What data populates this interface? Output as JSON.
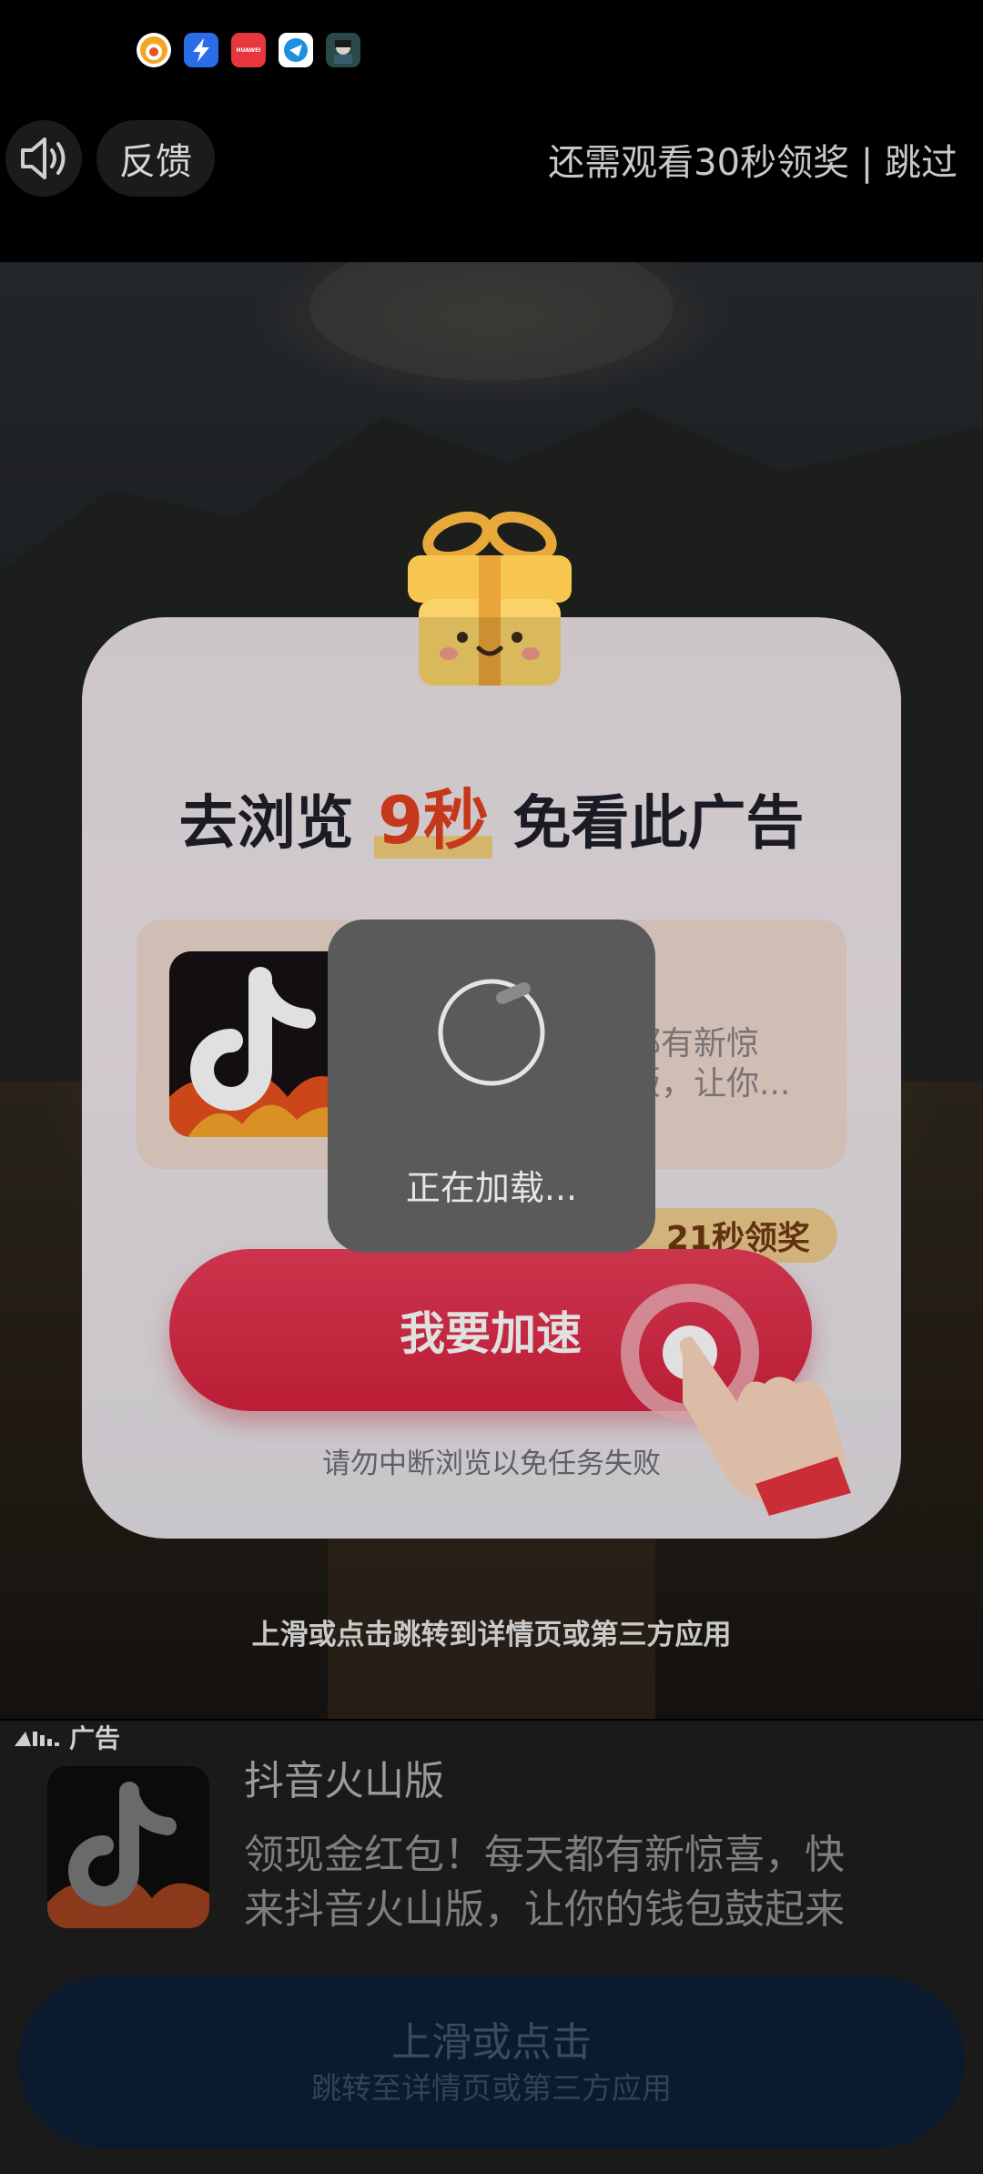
{
  "status_bar": {
    "icons": [
      "taobao-icon",
      "lightning-app-icon",
      "huawei-store-icon",
      "browser-icon",
      "game-icon"
    ],
    "huawei_label": "HUAWEI"
  },
  "top_bar": {
    "mute_icon": "speaker-icon",
    "feedback_label": "反馈",
    "skip_text": "还需观看30秒领奖 | 跳过"
  },
  "card": {
    "title_prefix": "去浏览",
    "title_highlight": "9秒",
    "title_suffix": "免看此广告",
    "app_desc_line1": "都有新惊",
    "app_desc_line2": "版，让你...",
    "countdown": "21秒领奖",
    "speed_button": "我要加速",
    "warning": "请勿中断浏览以免任务失败"
  },
  "loading": {
    "text": "正在加载..."
  },
  "video_hint": "上滑或点击跳转到详情页或第三方应用",
  "ad": {
    "label": "广告",
    "app_name": "抖音火山版",
    "desc_line1": "领现金红包！每天都有新惊喜，快",
    "desc_line2": "来抖音火山版，让你的钱包鼓起来",
    "cta_main": "上滑或点击",
    "cta_sub": "跳转至详情页或第三方应用"
  },
  "colors": {
    "accent_red": "#d92b45",
    "highlight_orange": "#e2401f",
    "pill_gold": "#efcc8e"
  }
}
